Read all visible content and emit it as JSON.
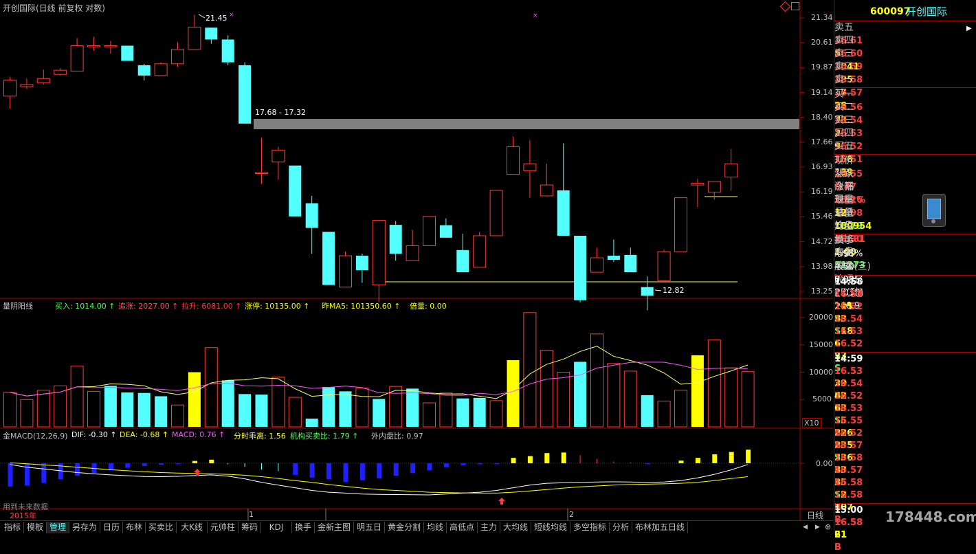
{
  "chart_title": "开创国际(日线 前复权 对数)",
  "price_axis": [
    "21.34",
    "20.61",
    "19.87",
    "19.14",
    "18.40",
    "17.66",
    "16.93",
    "16.19",
    "15.46",
    "14.72",
    "13.98",
    "13.25"
  ],
  "annotations": {
    "high": "21.45",
    "low": "12.82",
    "zone": "17.68 - 17.32"
  },
  "colors": {
    "up": "#ff3c3c",
    "down": "#54ffff",
    "yellow": "#ffff00",
    "bg": "#000000",
    "grid": "#b00000",
    "zone": "#808080"
  },
  "candles": [
    {
      "o": 18.62,
      "c": 19.15,
      "h": 19.26,
      "l": 18.22
    },
    {
      "o": 18.93,
      "c": 19.0,
      "h": 19.2,
      "l": 18.85
    },
    {
      "o": 19.06,
      "c": 19.2,
      "h": 19.5,
      "l": 19.0
    },
    {
      "o": 19.34,
      "c": 19.48,
      "h": 19.55,
      "l": 19.3
    },
    {
      "o": 19.45,
      "c": 20.33,
      "h": 20.6,
      "l": 19.45
    },
    {
      "o": 20.33,
      "c": 20.33,
      "h": 20.65,
      "l": 20.15
    },
    {
      "o": 20.33,
      "c": 20.33,
      "h": 20.5,
      "l": 20.05
    },
    {
      "o": 20.33,
      "c": 19.8,
      "h": 20.33,
      "l": 19.8
    },
    {
      "o": 19.65,
      "c": 19.3,
      "h": 19.7,
      "l": 19.14
    },
    {
      "o": 19.3,
      "c": 19.7,
      "h": 19.75,
      "l": 19.3
    },
    {
      "o": 19.7,
      "c": 20.2,
      "h": 20.45,
      "l": 19.6
    },
    {
      "o": 20.2,
      "c": 21.0,
      "h": 21.45,
      "l": 20.2
    },
    {
      "o": 20.98,
      "c": 20.55,
      "h": 20.98,
      "l": 20.4
    },
    {
      "o": 20.55,
      "c": 19.75,
      "h": 20.7,
      "l": 19.65
    },
    {
      "o": 19.65,
      "c": 17.75,
      "h": 19.75,
      "l": 17.75
    },
    {
      "o": 16.3,
      "c": 16.3,
      "h": 17.32,
      "l": 15.98
    },
    {
      "o": 16.6,
      "c": 16.95,
      "h": 17.05,
      "l": 16.1
    },
    {
      "o": 16.5,
      "c": 15.1,
      "h": 16.5,
      "l": 15.1
    },
    {
      "o": 15.45,
      "c": 14.8,
      "h": 15.65,
      "l": 14.15
    },
    {
      "o": 14.7,
      "c": 13.4,
      "h": 14.7,
      "l": 13.4
    },
    {
      "o": 13.35,
      "c": 14.1,
      "h": 14.2,
      "l": 13.35
    },
    {
      "o": 14.1,
      "c": 13.75,
      "h": 14.15,
      "l": 13.45
    },
    {
      "o": 13.4,
      "c": 15.0,
      "h": 15.0,
      "l": 13.0
    },
    {
      "o": 14.88,
      "c": 14.15,
      "h": 14.98,
      "l": 13.98
    },
    {
      "o": 13.98,
      "c": 14.35,
      "h": 14.75,
      "l": 13.98
    },
    {
      "o": 14.35,
      "c": 15.1,
      "h": 15.1,
      "l": 14.35
    },
    {
      "o": 14.87,
      "c": 14.55,
      "h": 15.05,
      "l": 14.55
    },
    {
      "o": 14.24,
      "c": 13.7,
      "h": 14.65,
      "l": 13.7
    },
    {
      "o": 13.82,
      "c": 14.6,
      "h": 14.7,
      "l": 13.82
    },
    {
      "o": 14.6,
      "c": 15.8,
      "h": 15.8,
      "l": 14.6
    },
    {
      "o": 16.25,
      "c": 17.05,
      "h": 17.35,
      "l": 16.25
    },
    {
      "o": 16.35,
      "c": 16.55,
      "h": 17.25,
      "l": 15.6
    },
    {
      "o": 15.65,
      "c": 15.95,
      "h": 16.55,
      "l": 15.65
    },
    {
      "o": 15.8,
      "c": 14.6,
      "h": 17.15,
      "l": 14.6
    },
    {
      "o": 14.6,
      "c": 13.05,
      "h": 14.6,
      "l": 13.0
    },
    {
      "o": 13.7,
      "c": 14.05,
      "h": 14.3,
      "l": 13.7
    },
    {
      "o": 14.1,
      "c": 14.0,
      "h": 14.5,
      "l": 13.95
    },
    {
      "o": 14.12,
      "c": 13.7,
      "h": 14.3,
      "l": 13.7
    },
    {
      "o": 13.35,
      "c": 13.15,
      "h": 13.6,
      "l": 12.82
    },
    {
      "o": 13.5,
      "c": 14.2,
      "h": 14.25,
      "l": 13.5
    },
    {
      "o": 14.2,
      "c": 15.6,
      "h": 15.6,
      "l": 14.2
    },
    {
      "o": 15.95,
      "c": 16.0,
      "h": 16.12,
      "l": 15.35
    },
    {
      "o": 15.75,
      "c": 16.05,
      "h": 16.05,
      "l": 15.55
    },
    {
      "o": 16.17,
      "c": 16.55,
      "h": 16.98,
      "l": 15.79
    }
  ],
  "volume_panel": {
    "title": "量阴阳线",
    "items": [
      {
        "label": "买入:",
        "value": "1014.00",
        "arrow": "↑",
        "color": "#54ff54"
      },
      {
        "label": "追涨:",
        "value": "2027.00",
        "arrow": "↑",
        "color": "#ff5454"
      },
      {
        "label": "拉升:",
        "value": "6081.00",
        "arrow": "↑",
        "color": "#ff3c3c"
      },
      {
        "label": "涨停:",
        "value": "10135.00",
        "arrow": "↑",
        "color": "#ffff00"
      },
      {
        "label": "昨MA5:",
        "value": "101350.60",
        "arrow": "↑",
        "color": "#ffff00"
      },
      {
        "label": "倍量:",
        "value": "0.00",
        "arrow": "",
        "color": "#ffff00"
      }
    ],
    "axis": [
      "20000",
      "15000",
      "10000",
      "5000"
    ],
    "unit": "X10",
    "bars": [
      {
        "v": 6300,
        "t": "u"
      },
      {
        "v": 5000,
        "t": "u"
      },
      {
        "v": 6700,
        "t": "u"
      },
      {
        "v": 7500,
        "t": "u"
      },
      {
        "v": 11100,
        "t": "u"
      },
      {
        "v": 6500,
        "t": "u"
      },
      {
        "v": 7500,
        "t": "d"
      },
      {
        "v": 6300,
        "t": "d"
      },
      {
        "v": 6200,
        "t": "d"
      },
      {
        "v": 5600,
        "t": "d"
      },
      {
        "v": 4000,
        "t": "u"
      },
      {
        "v": 10000,
        "t": "y"
      },
      {
        "v": 14500,
        "t": "u"
      },
      {
        "v": 8500,
        "t": "d"
      },
      {
        "v": 6000,
        "t": "d"
      },
      {
        "v": 5900,
        "t": "d"
      },
      {
        "v": 9100,
        "t": "u"
      },
      {
        "v": 5400,
        "t": "u"
      },
      {
        "v": 1500,
        "t": "d"
      },
      {
        "v": 7300,
        "t": "d"
      },
      {
        "v": 6500,
        "t": "d"
      },
      {
        "v": 7100,
        "t": "u"
      },
      {
        "v": 5100,
        "t": "d"
      },
      {
        "v": 7400,
        "t": "u"
      },
      {
        "v": 7000,
        "t": "d"
      },
      {
        "v": 4400,
        "t": "u"
      },
      {
        "v": 6200,
        "t": "u"
      },
      {
        "v": 5200,
        "t": "d"
      },
      {
        "v": 5300,
        "t": "d"
      },
      {
        "v": 4800,
        "t": "u"
      },
      {
        "v": 12200,
        "t": "y"
      },
      {
        "v": 20900,
        "t": "u"
      },
      {
        "v": 14000,
        "t": "u"
      },
      {
        "v": 10000,
        "t": "u"
      },
      {
        "v": 11900,
        "t": "d"
      },
      {
        "v": 17000,
        "t": "u"
      },
      {
        "v": 11600,
        "t": "u"
      },
      {
        "v": 10200,
        "t": "u"
      },
      {
        "v": 5800,
        "t": "d"
      },
      {
        "v": 4700,
        "t": "u"
      },
      {
        "v": 6700,
        "t": "u"
      },
      {
        "v": 13100,
        "t": "y"
      },
      {
        "v": 15900,
        "t": "u"
      },
      {
        "v": 10800,
        "t": "u"
      },
      {
        "v": 10100,
        "t": "u"
      }
    ]
  },
  "macd_panel": {
    "title": "金MACD(12,26,9)",
    "items": [
      {
        "label": "DIF:",
        "value": "-0.30",
        "arrow": "↑",
        "color": "#ffffff"
      },
      {
        "label": "DEA:",
        "value": "-0.68",
        "arrow": "↑",
        "color": "#ffff00"
      },
      {
        "label": "MACD:",
        "value": "0.76",
        "arrow": "↑",
        "color": "#ff54ff"
      },
      {
        "label": "分时乖离:",
        "value": "1.56",
        "arrow": "",
        "color": "#ffff00"
      },
      {
        "label": "机构买卖比:",
        "value": "1.79",
        "arrow": "↑",
        "color": "#54ff54"
      },
      {
        "label": "外内盘比:",
        "value": "0.97",
        "arrow": "",
        "color": "#c0c0c0"
      }
    ],
    "axis": "0.00",
    "note": "用到未来数据",
    "bars": [
      -1.3,
      -1.25,
      -1.1,
      -0.9,
      -0.7,
      -0.55,
      -0.4,
      -0.25,
      -0.15,
      -0.08,
      -0.04,
      0.13,
      0.2,
      -0.06,
      -0.2,
      -0.35,
      -0.45,
      -0.65,
      -0.8,
      -0.9,
      -1.05,
      -0.95,
      -0.85,
      -0.7,
      -0.55,
      -0.4,
      -0.22,
      -0.1,
      -0.05,
      -0.02,
      0.3,
      0.4,
      0.57,
      0.6,
      0.45,
      0.25,
      0.1,
      0.05,
      -0.04,
      0.01,
      0.15,
      0.3,
      0.5,
      0.63,
      0.76
    ],
    "bar_types": [
      "b",
      "b",
      "b",
      "b",
      "b",
      "b",
      "b",
      "b",
      "b",
      "b",
      "b",
      "y",
      "y",
      "c",
      "c",
      "c",
      "c",
      "b",
      "b",
      "b",
      "b",
      "b",
      "b",
      "b",
      "b",
      "b",
      "b",
      "b",
      "b",
      "b",
      "y",
      "y",
      "y",
      "y",
      "r",
      "r",
      "r",
      "r",
      "b",
      "r",
      "y",
      "y",
      "y",
      "y",
      "y"
    ],
    "dif": [
      -0.3,
      -0.45,
      -0.55,
      -0.65,
      -0.75,
      -0.82,
      -0.88,
      -0.93,
      -0.97,
      -0.98,
      -0.96,
      -0.92,
      -0.88,
      -0.95,
      -1.1,
      -1.3,
      -1.45,
      -1.6,
      -1.75,
      -1.85,
      -1.9,
      -1.95,
      -1.97,
      -1.98,
      -1.99,
      -2.0,
      -1.95,
      -1.9,
      -1.85,
      -1.75,
      -1.6,
      -1.45,
      -1.35,
      -1.32,
      -1.3,
      -1.28,
      -1.27,
      -1.28,
      -1.3,
      -1.28,
      -1.2,
      -1.05,
      -0.85,
      -0.6,
      -0.3
    ],
    "dea": [
      -0.2,
      -0.26,
      -0.32,
      -0.38,
      -0.45,
      -0.52,
      -0.59,
      -0.65,
      -0.7,
      -0.75,
      -0.78,
      -0.8,
      -0.82,
      -0.85,
      -0.9,
      -0.98,
      -1.08,
      -1.2,
      -1.3,
      -1.42,
      -1.52,
      -1.62,
      -1.7,
      -1.75,
      -1.8,
      -1.85,
      -1.87,
      -1.89,
      -1.9,
      -1.9,
      -1.85,
      -1.78,
      -1.7,
      -1.62,
      -1.55,
      -1.5,
      -1.45,
      -1.42,
      -1.4,
      -1.38,
      -1.35,
      -1.3,
      -1.2,
      -1.08,
      -0.98
    ]
  },
  "time_axis": [
    "2015年",
    "1",
    "2"
  ],
  "timeframe": "日线",
  "tabs": [
    "指标",
    "模板",
    "管理",
    "另存为",
    "日历",
    "布林",
    "买卖比",
    "大K线",
    "元帅柱",
    "筹码",
    "KDJ",
    "换手",
    "金新主图",
    "明五日",
    "黄金分割",
    "均线",
    "高低点",
    "主力",
    "大均线",
    "短线均线",
    "多空指标",
    "分析",
    "布林加五日线"
  ],
  "quote": {
    "code": "600097",
    "name": "开创国际",
    "asks": [
      {
        "label": "卖五",
        "price": "16.61",
        "vol": "5"
      },
      {
        "label": "卖四",
        "price": "16.60",
        "vol": "1041"
      },
      {
        "label": "卖三",
        "price": "16.59",
        "vol": "185"
      },
      {
        "label": "卖二",
        "price": "16.58",
        "vol": "17"
      },
      {
        "label": "卖一",
        "price": "16.57",
        "vol": "28"
      }
    ],
    "bids": [
      {
        "label": "买一",
        "price": "16.56",
        "vol": "73"
      },
      {
        "label": "买二",
        "price": "16.54",
        "vol": "2"
      },
      {
        "label": "买三",
        "price": "16.53",
        "vol": "9"
      },
      {
        "label": "买四",
        "price": "16.52",
        "vol": "158"
      },
      {
        "label": "买五",
        "price": "16.51",
        "vol": "139"
      }
    ],
    "stats": [
      {
        "l1": "现价",
        "v1": "16.55",
        "c1": "#ff3c3c",
        "l2": "今开",
        "v2": "16.16",
        "c2": "#ff3c3c"
      },
      {
        "l1": "涨跌",
        "v1": "0.47",
        "c1": "#ff3c3c",
        "l2": "最高",
        "v2": "16.98",
        "c2": "#ff3c3c"
      },
      {
        "l1": "涨幅",
        "v1": "2.92%",
        "c1": "#ff3c3c",
        "l2": "最低",
        "v2": "15.79",
        "c2": "#54ff54"
      },
      {
        "l1": "现量",
        "v1": "12",
        "c1": "#ffff00",
        "l2": "均价",
        "v2": "16.30",
        "c2": "#ff3c3c"
      },
      {
        "l1": "总量",
        "v1": "100954",
        "c1": "#ffff00",
        "l2": "量比",
        "v2": "1.00",
        "c2": "#ffff00"
      },
      {
        "l1": "外盘",
        "v1": "49681",
        "c1": "#ff3c3c",
        "l2": "内盘",
        "v2": "51273",
        "c2": "#54ff54"
      }
    ],
    "fund": [
      {
        "l1": "换手",
        "v1": "4.98%",
        "l2": "股本",
        "v2": "2.03亿"
      },
      {
        "l1": "净资",
        "v1": "4.50",
        "l2": "流通",
        "v2": "2.03亿"
      },
      {
        "l1": "收益(三)",
        "v1": "0.085",
        "l2": "PE(动)",
        "v2": "146.9"
      }
    ],
    "ticks": [
      {
        "time": "14:58",
        "price": "16.55",
        "vol": "105",
        "bs": "B"
      },
      {
        "time": "",
        "price": "16.52",
        "vol": "211",
        "bs": "S"
      },
      {
        "time": "",
        "price": "16.52",
        "vol": "33",
        "bs": "S"
      },
      {
        "time": "",
        "price": "16.54",
        "vol": "118",
        "bs": ""
      },
      {
        "time": "",
        "price": "16.53",
        "vol": "6",
        "bs": "S"
      },
      {
        "time": "",
        "price": "16.52",
        "vol": "23",
        "bs": "S"
      },
      {
        "time": "14:59",
        "price": "16.53",
        "vol": "29",
        "bs": "B"
      },
      {
        "time": "",
        "price": "16.53",
        "vol": "30",
        "bs": "S"
      },
      {
        "time": "",
        "price": "16.54",
        "vol": "42",
        "bs": "B"
      },
      {
        "time": "",
        "price": "16.52",
        "vol": "63",
        "bs": "S"
      },
      {
        "time": "",
        "price": "16.53",
        "vol": "15",
        "bs": "B"
      },
      {
        "time": "",
        "price": "16.55",
        "vol": "226",
        "bs": "B"
      },
      {
        "time": "",
        "price": "16.52",
        "vol": "235",
        "bs": "S"
      },
      {
        "time": "",
        "price": "16.57",
        "vol": "236",
        "bs": "B"
      },
      {
        "time": "",
        "price": "16.58",
        "vol": "33",
        "bs": "B"
      },
      {
        "time": "",
        "price": "16.57",
        "vol": "35",
        "bs": "S"
      },
      {
        "time": "",
        "price": "16.58",
        "vol": "12",
        "bs": "B"
      },
      {
        "time": "",
        "price": "16.58",
        "vol": "107",
        "bs": "B"
      },
      {
        "time": "15:00",
        "price": "16.58",
        "vol": "21",
        "bs": "B"
      },
      {
        "time": "",
        "price": "16.58",
        "vol": "61",
        "bs": "B"
      }
    ]
  },
  "watermark": "178448.com"
}
